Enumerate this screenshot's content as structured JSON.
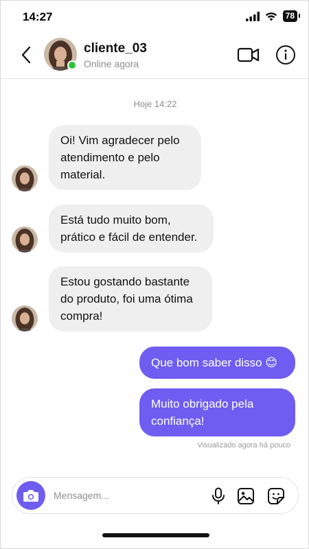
{
  "status_bar": {
    "time": "14:27",
    "battery": "78"
  },
  "header": {
    "contact_name": "cliente_03",
    "contact_status": "Online agora"
  },
  "chat": {
    "date_separator": "Hoje 14:22",
    "messages": [
      {
        "direction": "incoming",
        "text": "Oi! Vim agradecer pelo atendimento e pelo material."
      },
      {
        "direction": "incoming",
        "text": "Está tudo muito bom, prático e fácil de entender."
      },
      {
        "direction": "incoming",
        "text": "Estou gostando bastante do produto, foi uma ótima compra!"
      },
      {
        "direction": "outgoing",
        "text": "Que bom saber disso 😊"
      },
      {
        "direction": "outgoing",
        "text": "Muito obrigado pela confiança!"
      }
    ],
    "seen_status": "Visualizado agora há pouco"
  },
  "composer": {
    "placeholder": "Mensagem..."
  },
  "colors": {
    "accent": "#6e5df0",
    "online": "#2ec43a",
    "incoming_bubble": "#efefef"
  },
  "icons": [
    "back-icon",
    "video-call-icon",
    "info-icon",
    "camera-icon",
    "microphone-icon",
    "image-icon",
    "sticker-icon"
  ]
}
